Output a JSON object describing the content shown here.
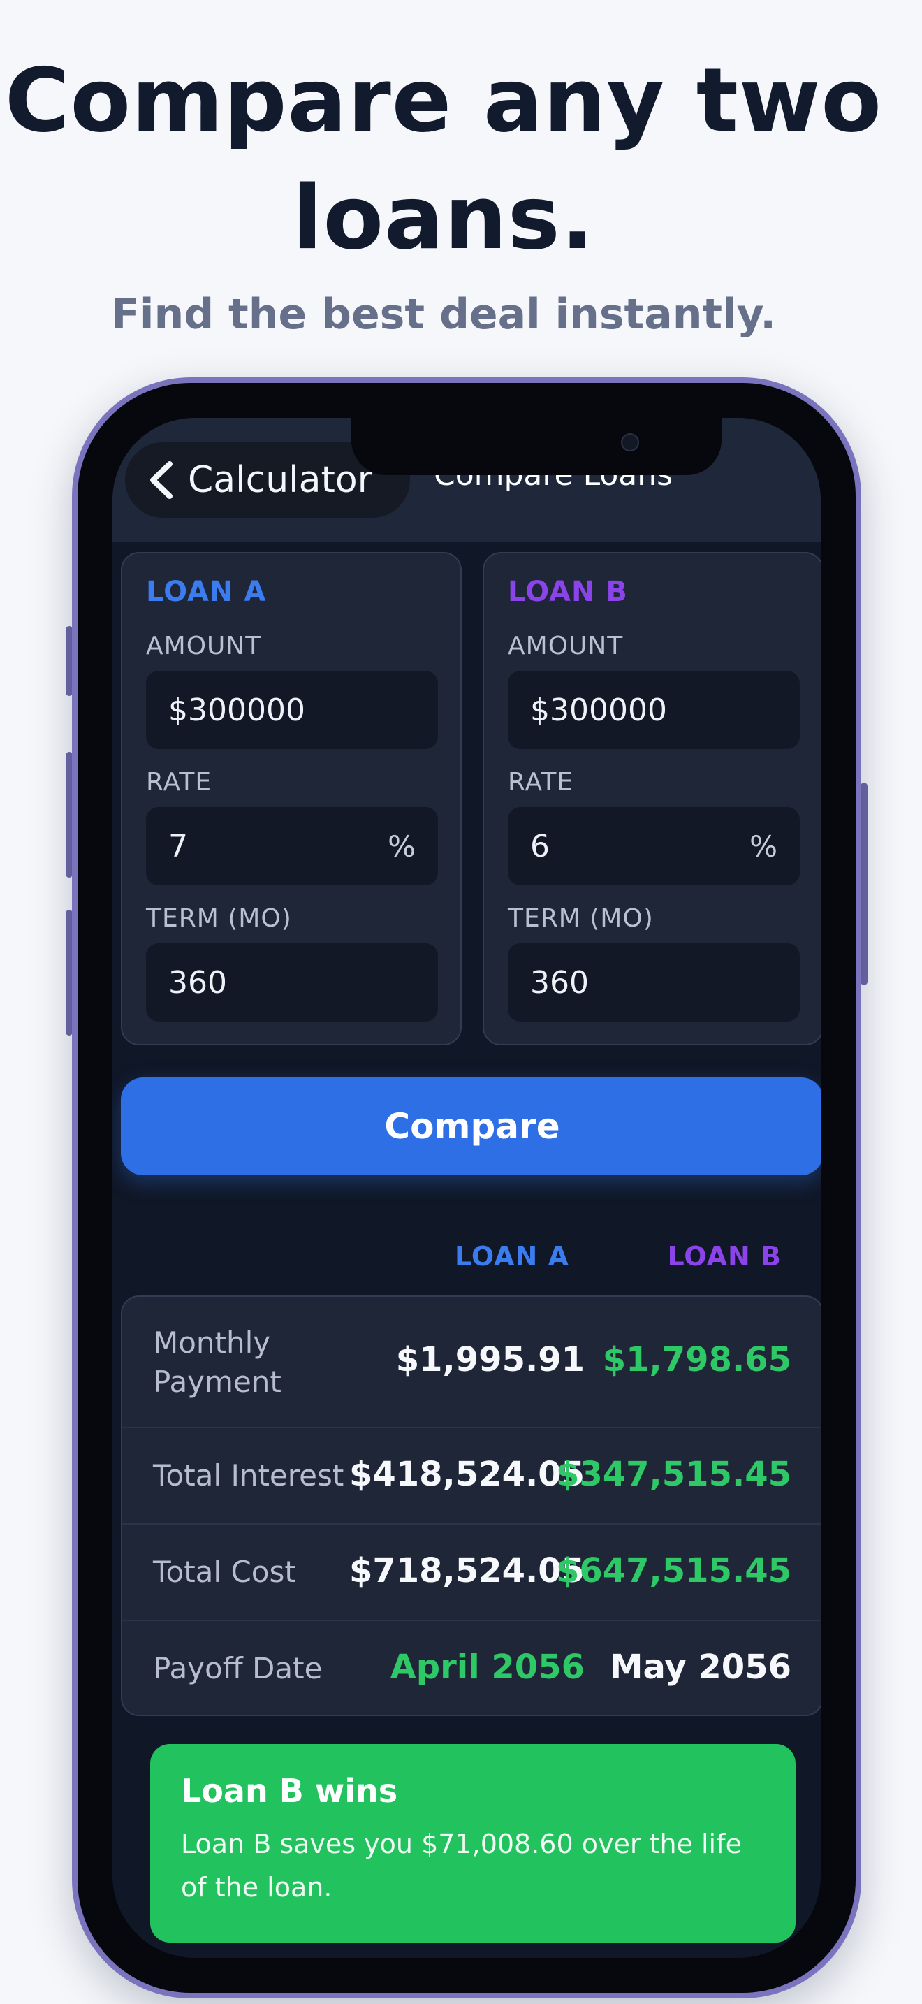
{
  "marketing": {
    "headline_line1": "Compare any two",
    "headline_line2": "loans.",
    "subheadline": "Find the best deal instantly."
  },
  "nav": {
    "back_label": "Calculator",
    "title": "Compare Loans"
  },
  "inputs": {
    "amount_label": "AMOUNT",
    "rate_label": "RATE",
    "term_label": "TERM (MO)",
    "percent_symbol": "%",
    "loan_a": {
      "title": "LOAN A",
      "amount": "$300000",
      "rate": "7",
      "term": "360"
    },
    "loan_b": {
      "title": "LOAN B",
      "amount": "$300000",
      "rate": "6",
      "term": "360"
    }
  },
  "compare_button_label": "Compare",
  "results": {
    "col_a": "LOAN A",
    "col_b": "LOAN B",
    "monthly_payment": {
      "label_line1": "Monthly",
      "label_line2": "Payment",
      "a": "$1,995.91",
      "b": "$1,798.65"
    },
    "total_interest": {
      "label": "Total Interest",
      "a": "$418,524.05",
      "b": "$347,515.45"
    },
    "total_cost": {
      "label": "Total Cost",
      "a": "$718,524.05",
      "b": "$647,515.45"
    },
    "payoff_date": {
      "label": "Payoff Date",
      "a": "April 2056",
      "b": "May 2056"
    }
  },
  "winner": {
    "title": "Loan B wins",
    "text": "Loan B saves you $71,008.60 over the life of the loan."
  },
  "colors": {
    "loan_a_accent": "#3b7cf0",
    "loan_b_accent": "#8a44ea",
    "winner_green": "#22c35e",
    "better_value_green": "#2ec866",
    "primary_button": "#2f6fe6"
  }
}
